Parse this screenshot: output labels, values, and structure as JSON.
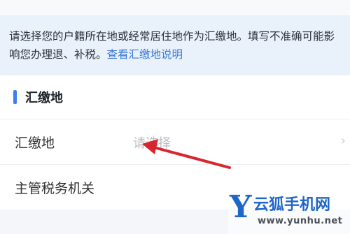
{
  "notice": {
    "text": "请选择您的户籍所在地或经常居住地作为汇缴地。填写不准确可能影响您办理退、补税。",
    "link": "查看汇缴地说明"
  },
  "section": {
    "title": "汇缴地"
  },
  "rows": [
    {
      "label": "汇缴地",
      "value": "请选择",
      "chevron": "›"
    },
    {
      "label": "主管税务机关",
      "value": ""
    }
  ],
  "watermark": {
    "logo": "Y",
    "name": "云狐手机网",
    "url": "www.yunhu.net"
  },
  "colors": {
    "accent": "#3b7ff0",
    "link": "#3a79d6",
    "arrow": "#d8262e",
    "notice_bg": "#e9f1fb"
  }
}
